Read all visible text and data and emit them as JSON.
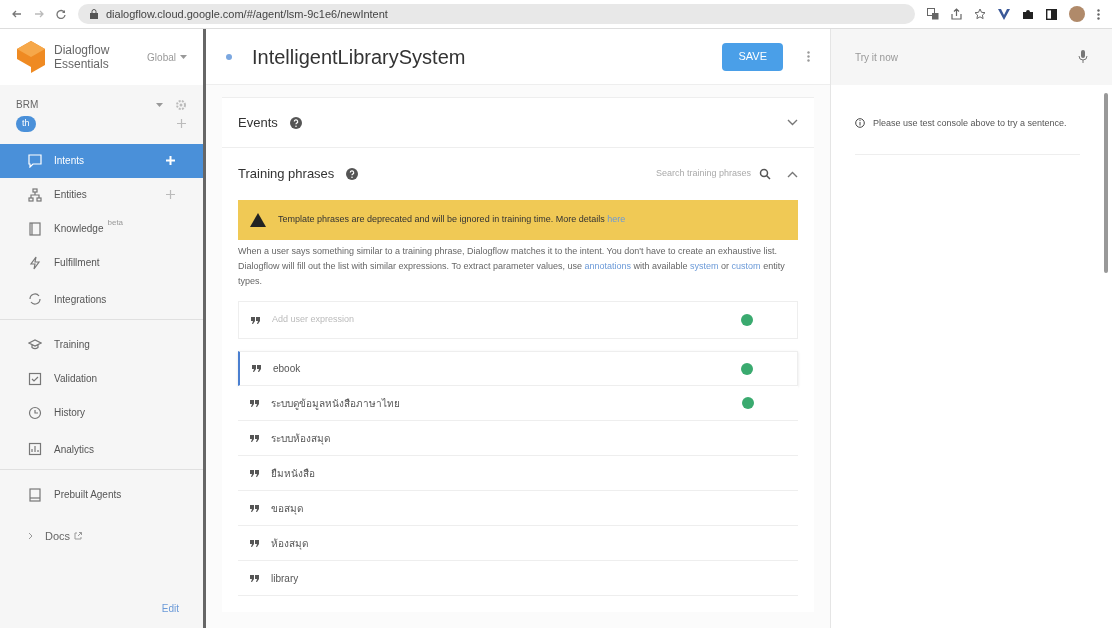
{
  "browser": {
    "url": "dialogflow.cloud.google.com/#/agent/lsm-9c1e6/newIntent"
  },
  "sidebar": {
    "product": [
      "Dialogflow",
      "Essentials"
    ],
    "region": "Global",
    "agent": "BRM",
    "language": "th",
    "items": [
      {
        "label": "Intents",
        "selected": true,
        "add": true
      },
      {
        "label": "Entities",
        "selected": false,
        "add": true
      },
      {
        "label": "Knowledge",
        "selected": false,
        "add": false,
        "badge": "beta"
      },
      {
        "label": "Fulfillment",
        "selected": false,
        "add": false
      },
      {
        "label": "Integrations",
        "selected": false,
        "add": false,
        "divider_after": true
      },
      {
        "label": "Training",
        "selected": false,
        "add": false
      },
      {
        "label": "Validation",
        "selected": false,
        "add": false
      },
      {
        "label": "History",
        "selected": false,
        "add": false
      },
      {
        "label": "Analytics",
        "selected": false,
        "add": false,
        "divider_after": true
      },
      {
        "label": "Prebuilt Agents",
        "selected": false,
        "add": false
      }
    ],
    "docs": "Docs",
    "footer": "Edit"
  },
  "intent": {
    "name": "IntelligentLibrarySystem",
    "save": "SAVE"
  },
  "events": {
    "title": "Events"
  },
  "training": {
    "title": "Training phrases",
    "search_placeholder": "Search training phrases",
    "warning": "Template phrases are deprecated and will be ignored in training time. More details ",
    "warning_link": "here",
    "help": [
      "When a user says something similar to a training phrase, Dialogflow matches it to the intent. You don't have to create an exhaustive list. Dialogflow will fill out the list with similar expressions. To extract parameter values, use ",
      {
        "link": "annotations"
      },
      " with available ",
      {
        "link": "system"
      },
      " or ",
      {
        "link": "custom"
      },
      " entity types."
    ],
    "input_placeholder": "Add user expression",
    "phrases": [
      {
        "text": "ebook",
        "selected": true,
        "annotated": true
      },
      {
        "text": "ระบบดูข้อมูลหนังสือภาษาไทย",
        "selected": false,
        "annotated": true
      },
      {
        "text": "ระบบห้องสมุด",
        "selected": false,
        "annotated": false
      },
      {
        "text": "ยืมหนังสือ",
        "selected": false,
        "annotated": false
      },
      {
        "text": "ขอสมุด",
        "selected": false,
        "annotated": false
      },
      {
        "text": "ห้องสมุด",
        "selected": false,
        "annotated": false
      },
      {
        "text": "library",
        "selected": false,
        "annotated": false
      }
    ]
  },
  "console": {
    "placeholder": "Try it now",
    "note": "Please use test console above to try a sentence."
  }
}
